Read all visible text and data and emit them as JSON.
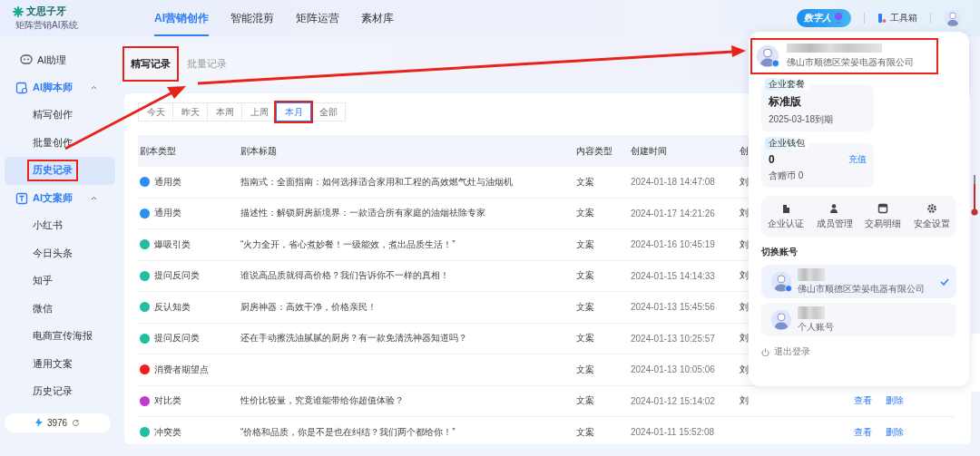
{
  "logo": {
    "name": "文思子牙",
    "tagline": "矩阵营销AI系统"
  },
  "nav": [
    {
      "label": "AI营销创作",
      "selected": true
    },
    {
      "label": "智能混剪",
      "selected": false
    },
    {
      "label": "矩阵运营",
      "selected": false
    },
    {
      "label": "素材库",
      "selected": false
    }
  ],
  "header_actions": {
    "digital_human": "数字人",
    "toolbox": "工具箱"
  },
  "sidebar": {
    "items": [
      {
        "kind": "link",
        "label": "AI助理"
      },
      {
        "kind": "group",
        "label": "AI脚本师",
        "expanded": true,
        "children": [
          {
            "label": "精写创作",
            "selected": false,
            "highlighted": false
          },
          {
            "label": "批量创作",
            "selected": false,
            "highlighted": false
          },
          {
            "label": "历史记录",
            "selected": true,
            "highlighted": true
          }
        ]
      },
      {
        "kind": "group",
        "label": "AI文案师",
        "expanded": true,
        "children": [
          {
            "label": "小红书",
            "selected": false,
            "highlighted": false
          },
          {
            "label": "今日头条",
            "selected": false,
            "highlighted": false
          },
          {
            "label": "知乎",
            "selected": false,
            "highlighted": false
          },
          {
            "label": "微信",
            "selected": false,
            "highlighted": false
          },
          {
            "label": "电商宣传海报",
            "selected": false,
            "highlighted": false
          },
          {
            "label": "通用文案",
            "selected": false,
            "highlighted": false
          },
          {
            "label": "历史记录",
            "selected": false,
            "highlighted": false
          }
        ]
      }
    ],
    "balance": "3976"
  },
  "record_tabs": [
    {
      "label": "精写记录",
      "selected": true,
      "highlighted": true
    },
    {
      "label": "批量记录",
      "selected": false,
      "highlighted": false
    }
  ],
  "filters": [
    {
      "label": "今天",
      "selected": false,
      "highlighted": false
    },
    {
      "label": "昨天",
      "selected": false,
      "highlighted": false
    },
    {
      "label": "本周",
      "selected": false,
      "highlighted": false
    },
    {
      "label": "上周",
      "selected": false,
      "highlighted": false
    },
    {
      "label": "本月",
      "selected": true,
      "highlighted": true
    },
    {
      "label": "全部",
      "selected": false,
      "highlighted": false
    }
  ],
  "table": {
    "columns": [
      "剧本类型",
      "剧本标题",
      "内容类型",
      "创建时间",
      "创"
    ],
    "rows": [
      {
        "type": "通用类",
        "color": "#2b8ff0",
        "title": "指南式：全面指南：如何选择适合家用和工程的高效燃气灶与油烟机",
        "content_type": "文案",
        "created": "2024-01-18 14:47:08",
        "column_5": "刘"
      },
      {
        "type": "通用类",
        "color": "#2b8ff0",
        "title": "描述性：解锁厨房新境界：一款适合所有家庭的油烟祛除专家",
        "content_type": "文案",
        "created": "2024-01-17 14:21:26",
        "column_5": "刘"
      },
      {
        "type": "爆吸引类",
        "color": "#1fbf9f",
        "title": "“火力全开，省心煮妙餐！一级能效，煮出品质生活！”",
        "content_type": "文案",
        "created": "2024-01-16 10:45:19",
        "column_5": "刘"
      },
      {
        "type": "提问反问类",
        "color": "#1fbf9f",
        "title": "谁说高品质就得高价格？我们告诉你不一样的真相！",
        "content_type": "文案",
        "created": "2024-01-15 14:14:33",
        "column_5": "刘"
      },
      {
        "type": "反认知类",
        "color": "#1fbf9f",
        "title": "厨房神器：高效干净，价格亲民！",
        "content_type": "文案",
        "created": "2024-01-13 15:45:56",
        "column_5": "刘"
      },
      {
        "type": "提问反问类",
        "color": "#1fbf9f",
        "title": "还在手动擦洗油腻腻的厨房？有一款免清洗神器知道吗？",
        "content_type": "文案",
        "created": "2024-01-13 10:25:57",
        "column_5": "刘"
      },
      {
        "type": "消费者期望点",
        "color": "#f01e1e",
        "content_type": "文案",
        "created": "2024-01-13 10:05:06",
        "column_5": "刘"
      },
      {
        "type": "对比类",
        "color": "#c03ad0",
        "title": "性价比较量，究竟谁能带给你超值体验？",
        "content_type": "文案",
        "created": "2024-01-12 15:14:02",
        "column_5": "刘",
        "actions": [
          "查看",
          "删除"
        ]
      },
      {
        "type": "冲突类",
        "color": "#1fbf9f",
        "title": "“价格和品质，你是不是也在纠结？我们两个都给你！”",
        "content_type": "文案",
        "created": "2024-01-11 15:52:08",
        "actions": [
          "查看",
          "删除"
        ]
      }
    ]
  },
  "account_panel": {
    "company": "佛山市顺德区荣晏电器有限公司",
    "highlighted": true,
    "plan": {
      "label": "企业套餐",
      "name": "标准版",
      "expires": "2025-03-18到期"
    },
    "wallet": {
      "label": "企业钱包",
      "balance": "0",
      "recharge": "充值",
      "bonus": "含赠币 0"
    },
    "shortcuts": [
      "企业认证",
      "成员管理",
      "交易明细",
      "安全设置"
    ],
    "switch_title": "切换账号",
    "accounts": [
      {
        "subtitle": "佛山市顺德区荣晏电器有限公司",
        "selected": true
      },
      {
        "subtitle": "个人账号",
        "selected": false
      }
    ],
    "logout": "退出登录"
  }
}
